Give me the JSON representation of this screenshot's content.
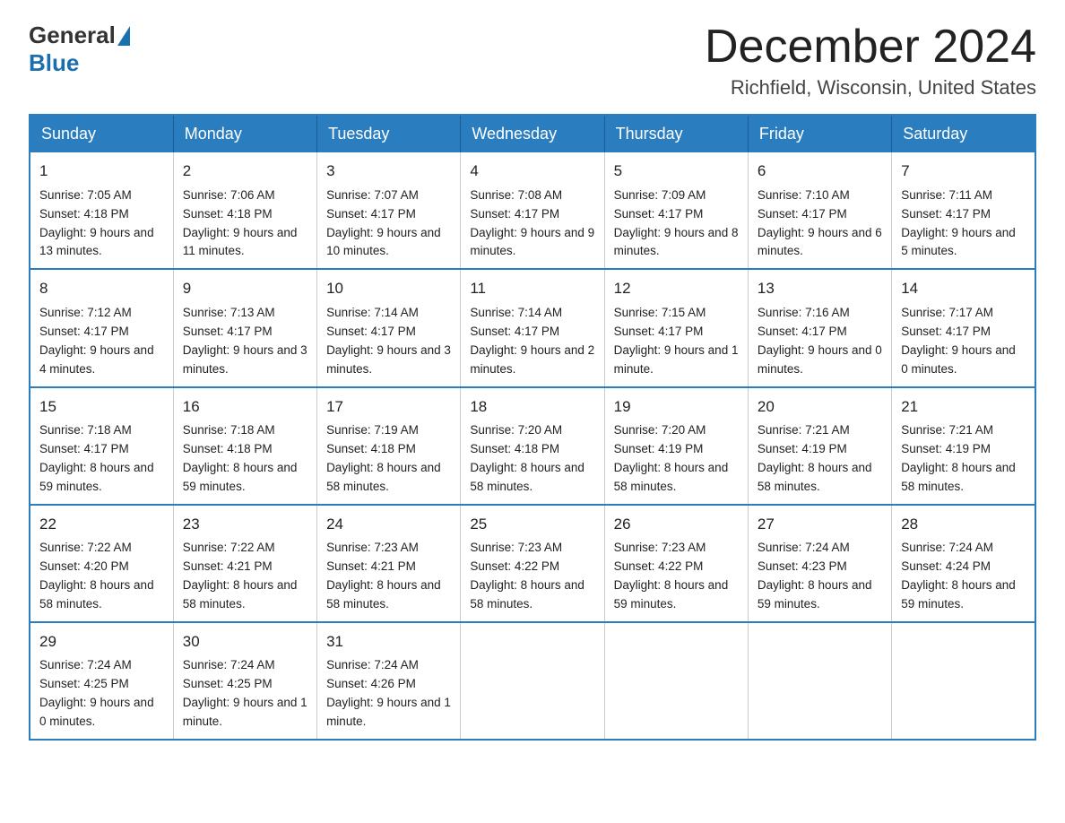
{
  "header": {
    "logo_general": "General",
    "logo_blue": "Blue",
    "month_title": "December 2024",
    "location": "Richfield, Wisconsin, United States"
  },
  "weekdays": [
    "Sunday",
    "Monday",
    "Tuesday",
    "Wednesday",
    "Thursday",
    "Friday",
    "Saturday"
  ],
  "weeks": [
    [
      {
        "day": "1",
        "sunrise": "7:05 AM",
        "sunset": "4:18 PM",
        "daylight": "9 hours and 13 minutes."
      },
      {
        "day": "2",
        "sunrise": "7:06 AM",
        "sunset": "4:18 PM",
        "daylight": "9 hours and 11 minutes."
      },
      {
        "day": "3",
        "sunrise": "7:07 AM",
        "sunset": "4:17 PM",
        "daylight": "9 hours and 10 minutes."
      },
      {
        "day": "4",
        "sunrise": "7:08 AM",
        "sunset": "4:17 PM",
        "daylight": "9 hours and 9 minutes."
      },
      {
        "day": "5",
        "sunrise": "7:09 AM",
        "sunset": "4:17 PM",
        "daylight": "9 hours and 8 minutes."
      },
      {
        "day": "6",
        "sunrise": "7:10 AM",
        "sunset": "4:17 PM",
        "daylight": "9 hours and 6 minutes."
      },
      {
        "day": "7",
        "sunrise": "7:11 AM",
        "sunset": "4:17 PM",
        "daylight": "9 hours and 5 minutes."
      }
    ],
    [
      {
        "day": "8",
        "sunrise": "7:12 AM",
        "sunset": "4:17 PM",
        "daylight": "9 hours and 4 minutes."
      },
      {
        "day": "9",
        "sunrise": "7:13 AM",
        "sunset": "4:17 PM",
        "daylight": "9 hours and 3 minutes."
      },
      {
        "day": "10",
        "sunrise": "7:14 AM",
        "sunset": "4:17 PM",
        "daylight": "9 hours and 3 minutes."
      },
      {
        "day": "11",
        "sunrise": "7:14 AM",
        "sunset": "4:17 PM",
        "daylight": "9 hours and 2 minutes."
      },
      {
        "day": "12",
        "sunrise": "7:15 AM",
        "sunset": "4:17 PM",
        "daylight": "9 hours and 1 minute."
      },
      {
        "day": "13",
        "sunrise": "7:16 AM",
        "sunset": "4:17 PM",
        "daylight": "9 hours and 0 minutes."
      },
      {
        "day": "14",
        "sunrise": "7:17 AM",
        "sunset": "4:17 PM",
        "daylight": "9 hours and 0 minutes."
      }
    ],
    [
      {
        "day": "15",
        "sunrise": "7:18 AM",
        "sunset": "4:17 PM",
        "daylight": "8 hours and 59 minutes."
      },
      {
        "day": "16",
        "sunrise": "7:18 AM",
        "sunset": "4:18 PM",
        "daylight": "8 hours and 59 minutes."
      },
      {
        "day": "17",
        "sunrise": "7:19 AM",
        "sunset": "4:18 PM",
        "daylight": "8 hours and 58 minutes."
      },
      {
        "day": "18",
        "sunrise": "7:20 AM",
        "sunset": "4:18 PM",
        "daylight": "8 hours and 58 minutes."
      },
      {
        "day": "19",
        "sunrise": "7:20 AM",
        "sunset": "4:19 PM",
        "daylight": "8 hours and 58 minutes."
      },
      {
        "day": "20",
        "sunrise": "7:21 AM",
        "sunset": "4:19 PM",
        "daylight": "8 hours and 58 minutes."
      },
      {
        "day": "21",
        "sunrise": "7:21 AM",
        "sunset": "4:19 PM",
        "daylight": "8 hours and 58 minutes."
      }
    ],
    [
      {
        "day": "22",
        "sunrise": "7:22 AM",
        "sunset": "4:20 PM",
        "daylight": "8 hours and 58 minutes."
      },
      {
        "day": "23",
        "sunrise": "7:22 AM",
        "sunset": "4:21 PM",
        "daylight": "8 hours and 58 minutes."
      },
      {
        "day": "24",
        "sunrise": "7:23 AM",
        "sunset": "4:21 PM",
        "daylight": "8 hours and 58 minutes."
      },
      {
        "day": "25",
        "sunrise": "7:23 AM",
        "sunset": "4:22 PM",
        "daylight": "8 hours and 58 minutes."
      },
      {
        "day": "26",
        "sunrise": "7:23 AM",
        "sunset": "4:22 PM",
        "daylight": "8 hours and 59 minutes."
      },
      {
        "day": "27",
        "sunrise": "7:24 AM",
        "sunset": "4:23 PM",
        "daylight": "8 hours and 59 minutes."
      },
      {
        "day": "28",
        "sunrise": "7:24 AM",
        "sunset": "4:24 PM",
        "daylight": "8 hours and 59 minutes."
      }
    ],
    [
      {
        "day": "29",
        "sunrise": "7:24 AM",
        "sunset": "4:25 PM",
        "daylight": "9 hours and 0 minutes."
      },
      {
        "day": "30",
        "sunrise": "7:24 AM",
        "sunset": "4:25 PM",
        "daylight": "9 hours and 1 minute."
      },
      {
        "day": "31",
        "sunrise": "7:24 AM",
        "sunset": "4:26 PM",
        "daylight": "9 hours and 1 minute."
      },
      null,
      null,
      null,
      null
    ]
  ]
}
